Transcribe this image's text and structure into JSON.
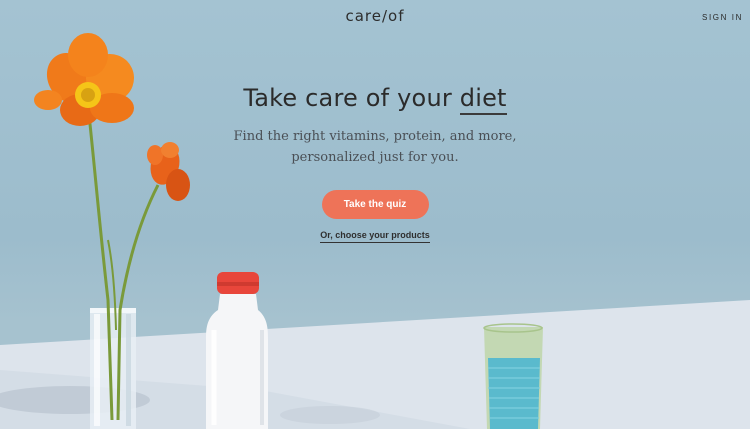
{
  "nav": {
    "logo": "care/of",
    "sign_in": "SIGN IN"
  },
  "hero": {
    "headline_prefix": "Take care of your ",
    "headline_accent": "diet",
    "subtext_line1": "Find the right vitamins, protein, and more,",
    "subtext_line2": "personalized just for you.",
    "cta_label": "Take the quiz",
    "secondary_link": "Or, choose your products"
  },
  "colors": {
    "background": "#9fbfcf",
    "cta": "#ee7358",
    "table": "#dfe6ee"
  }
}
